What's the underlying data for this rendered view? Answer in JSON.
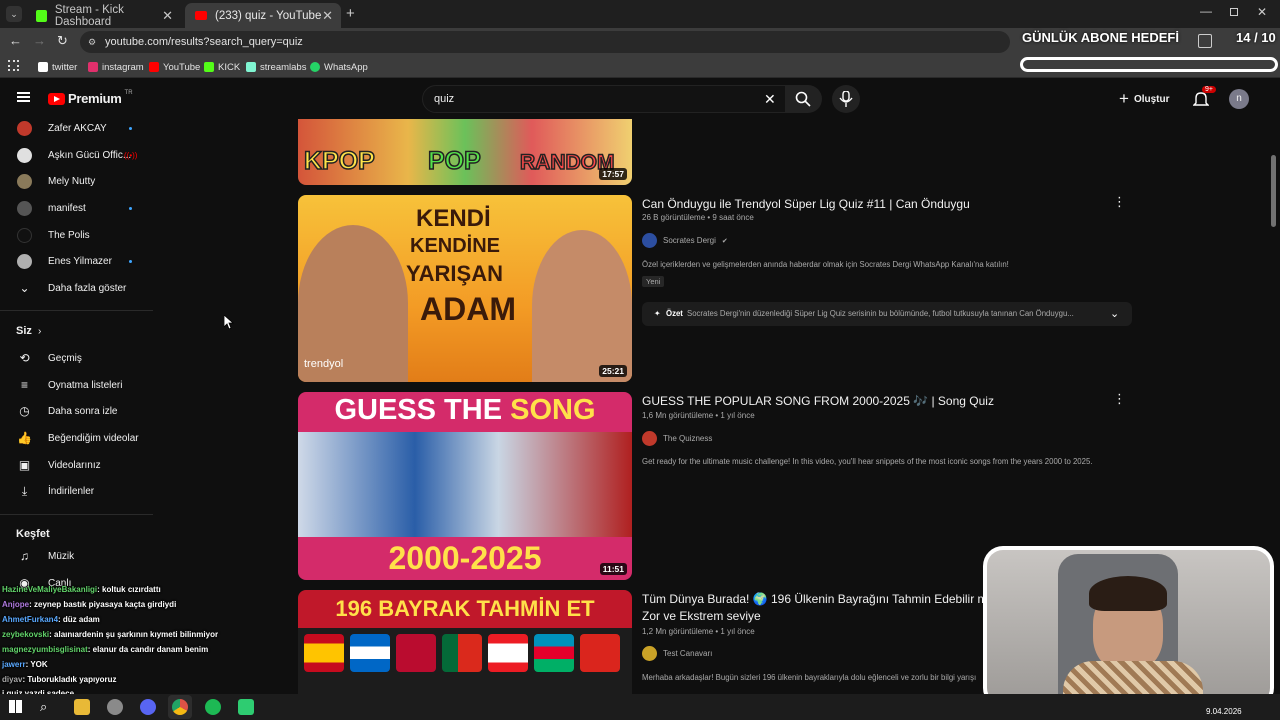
{
  "browser": {
    "tabs": [
      {
        "label": "Stream - Kick Dashboard",
        "icon": "kick-icon"
      },
      {
        "label": "(233) quiz - YouTube",
        "icon": "youtube-icon"
      }
    ],
    "url": "youtube.com/results?search_query=quiz",
    "bookmarks": [
      "twitter",
      "instagram",
      "YouTube",
      "KICK",
      "streamlabs",
      "WhatsApp"
    ]
  },
  "overlay": {
    "goal_label": "GÜNLÜK ABONE HEDEFİ",
    "goal_count": "14 / 10"
  },
  "youtube": {
    "logo": "Premium",
    "logo_region": "TR",
    "search_value": "quiz",
    "create_label": "Oluştur",
    "notif_badge": "9+",
    "user_initial": "n"
  },
  "sidebar": {
    "subscriptions": [
      {
        "label": "Zafer AKCAY",
        "dot": true,
        "color": "#c0392b"
      },
      {
        "label": "Aşkın Gücü Offic...",
        "live": true,
        "color": "#e0e0e0"
      },
      {
        "label": "Mely Nutty",
        "dot": false,
        "color": "#8a7a5a"
      },
      {
        "label": "manifest",
        "dot": true,
        "color": "#555555"
      },
      {
        "label": "The Polis",
        "dot": false,
        "color": "#111111"
      },
      {
        "label": "Enes Yilmazer",
        "dot": true,
        "color": "#b0b0b0"
      }
    ],
    "show_more": "Daha fazla göster",
    "you_header": "Siz",
    "you_items": [
      {
        "label": "Geçmiş",
        "icon": "history-icon"
      },
      {
        "label": "Oynatma listeleri",
        "icon": "playlist-icon"
      },
      {
        "label": "Daha sonra izle",
        "icon": "watch-later-icon"
      },
      {
        "label": "Beğendiğim videolar",
        "icon": "like-icon"
      },
      {
        "label": "Videolarınız",
        "icon": "your-videos-icon"
      },
      {
        "label": "İndirilenler",
        "icon": "download-icon"
      }
    ],
    "explore_header": "Keşfet",
    "explore_items": [
      {
        "label": "Müzik",
        "icon": "music-icon"
      },
      {
        "label": "Canlı",
        "icon": "live-icon"
      }
    ]
  },
  "results": [
    {
      "title": "Can Önduygu ile Trendyol Süper Lig Quiz #11 | Can Önduygu",
      "meta": "26 B görüntüleme • 9 saat önce",
      "channel": "Socrates Dergi",
      "channel_color": "#2c4ea0",
      "desc": "Özel içeriklerden ve gelişmelerden anında haberdar olmak için Socrates Dergi WhatsApp Kanalı'na katılın!",
      "badge": "Yeni",
      "summary_label": "Özet",
      "summary": "Socrates Dergi'nin düzenlediği Süper Lig Quiz serisinin bu bölümünde, futbol tutkusuyla tanınan Can Önduygu...",
      "duration": "25:21",
      "thumb_text": [
        "KENDİ",
        "KENDİNE",
        "YARIŞAN",
        "ADAM"
      ],
      "thumb_brand": "trendyol"
    },
    {
      "title": "GUESS THE POPULAR SONG FROM 2000-2025 🎶 | Song Quiz",
      "meta": "1,6 Mn görüntüleme • 1 yıl önce",
      "channel": "The Quizness",
      "channel_color": "#c0392b",
      "desc": "Get ready for the ultimate music challenge! In this video, you'll hear snippets of the most iconic songs from the years 2000 to 2025.",
      "duration": "11:51",
      "thumb_text": [
        "GUESS THE",
        "SONG",
        "2000-2025"
      ]
    },
    {
      "title_line1": "Tüm Dünya Burada! 🌍 196 Ülkenin Bayrağını Tahmin Edebilir mi",
      "title_line2": "Zor ve Ekstrem seviye",
      "meta": "1,2 Mn görüntüleme • 1 yıl önce",
      "channel": "Test Canavarı",
      "channel_color": "#c9a227",
      "desc": "Merhaba arkadaşlar! Bugün sizleri 196 ülkenin bayraklarıyla dolu eğlenceli ve zorlu bir bilgi yarışı",
      "thumb_text": "196 BAYRAK TAHMİN ET"
    }
  ],
  "top_thumb": {
    "labels": [
      "KPOP",
      "POP",
      "RANDOM"
    ],
    "duration": "17:57"
  },
  "chat": [
    {
      "user": "HazineVeMaliyeBakanligi",
      "msg": ": koltuk cızırdattı"
    },
    {
      "user": "Anjope",
      "msg": ": zeynep bastık piyasaya kaçta girdiydi"
    },
    {
      "user": "AhmetFurkan4",
      "msg": ": düz adam"
    },
    {
      "user": "zeybekovski",
      "msg": ": alaınıardenin şu şarkının kıymeti bilinmiyor"
    },
    {
      "user": "magnezyumbisglisinat",
      "msg": ": elanur da candır danam benim"
    },
    {
      "user": "jawerr",
      "msg": ": YOK"
    },
    {
      "user": "diyav",
      "msg": ": Tuborukladık yapıyoruz"
    },
    {
      "user": "",
      "msg": "i quiz yazdi sadece"
    }
  ],
  "taskbar": {
    "date": "9.04.2026"
  }
}
